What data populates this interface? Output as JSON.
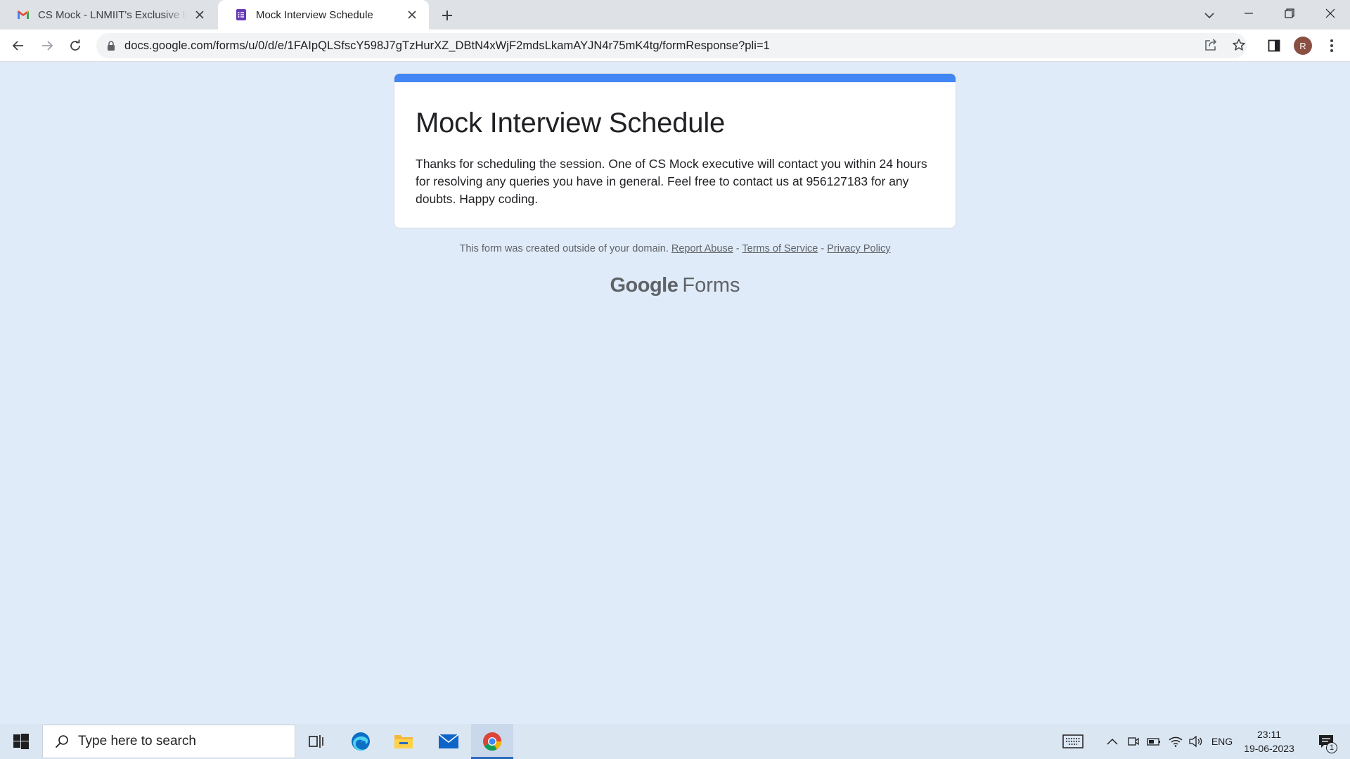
{
  "browser": {
    "tabs": [
      {
        "title": "CS Mock - LNMIIT's Exclusive Interview",
        "icon": "gmail-icon",
        "active": false
      },
      {
        "title": "Mock Interview Schedule",
        "icon": "google-forms-icon",
        "active": true
      }
    ],
    "url": "docs.google.com/forms/u/0/d/e/1FAIpQLSfscY598J7gTzHurXZ_DBtN4xWjF2mdsLkamAYJN4r75mK4tg/formResponse?pli=1",
    "profile_initial": "R",
    "accent": "#4285f4"
  },
  "form": {
    "title": "Mock Interview Schedule",
    "message": "Thanks for scheduling the session. One of CS Mock executive will contact you within 24 hours for resolving any queries you have in general. Feel free to contact us at 956127183 for any doubts. Happy coding."
  },
  "footer": {
    "note": "This form was created outside of your domain.",
    "report_abuse": "Report Abuse",
    "separator": " - ",
    "terms": "Terms of Service",
    "privacy": "Privacy Policy",
    "brand_google": "Google",
    "brand_forms": "Forms"
  },
  "taskbar": {
    "search_placeholder": "Type here to search",
    "language": "ENG",
    "time": "23:11",
    "date": "19-06-2023",
    "notification_count": "1"
  }
}
